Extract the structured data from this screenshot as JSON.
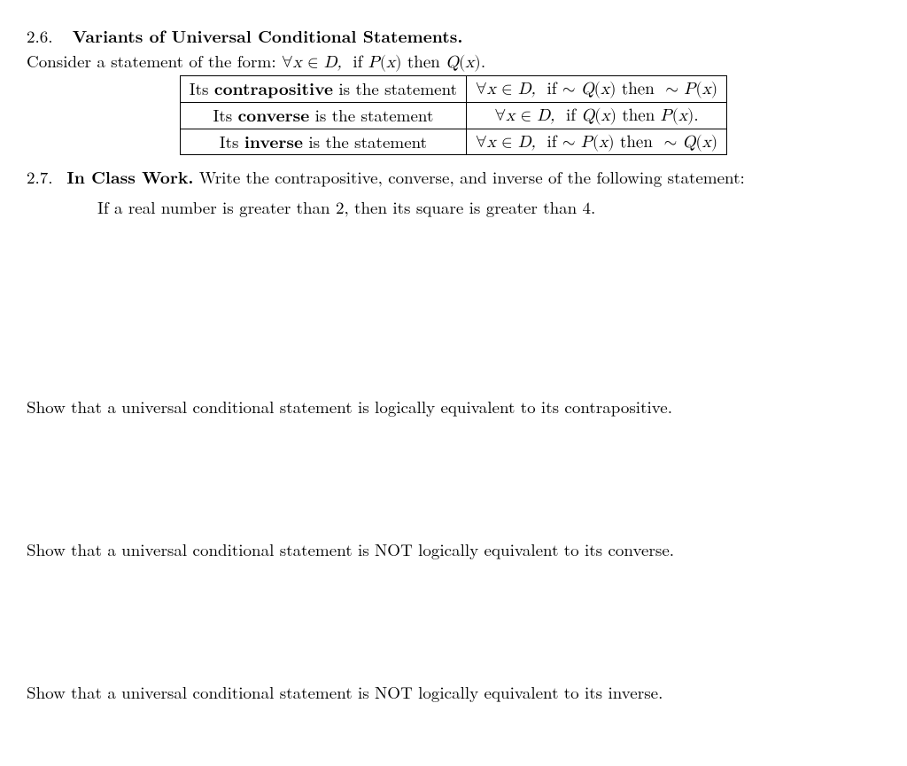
{
  "sec26": {
    "num": "2.6.",
    "title": "Variants of Universal Conditional Statements.",
    "intro_pre": "Consider a statement of the form: ",
    "intro_math": "∀x ∈ D,  if P(x) then Q(x).",
    "rows": [
      {
        "left_pre": "Its ",
        "left_bold": "contrapositive",
        "left_post": " is the statement",
        "right": "∀x ∈ D,  if ∼ Q(x) then  ∼ P(x)"
      },
      {
        "left_pre": "Its ",
        "left_bold": "converse",
        "left_post": " is the statement",
        "right": "∀x ∈ D,  if Q(x) then P(x)."
      },
      {
        "left_pre": "Its ",
        "left_bold": "inverse",
        "left_post": " is the statement",
        "right": "∀x ∈ D,  if ∼ P(x) then  ∼ Q(x)"
      }
    ]
  },
  "sec27": {
    "num": "2.7.",
    "title": "In Class Work.",
    "lead": " Write the contrapositive, converse, and inverse of the following statement:",
    "stmt": "If a real number is greater than 2, then its square is greater than 4.",
    "task1": "Show that a universal conditional statement is logically equivalent to its contrapositive.",
    "task2": "Show that a universal conditional statement is NOT logically equivalent to its converse.",
    "task3": "Show that a universal conditional statement is NOT logically equivalent to its inverse."
  }
}
